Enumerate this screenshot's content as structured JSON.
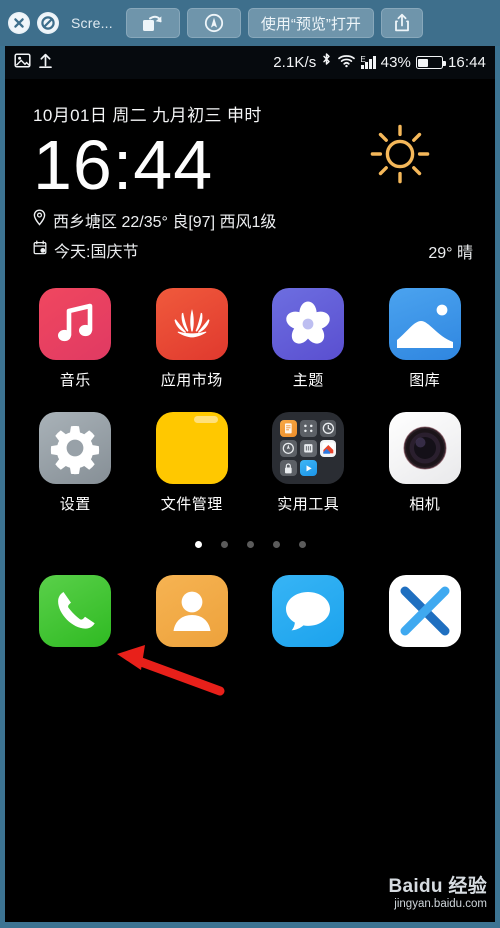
{
  "quicklook": {
    "close_label": "close",
    "block_label": "block",
    "title": "Scre...",
    "rotate_label": "rotate",
    "markup_label": "markup",
    "open_with_label": "使用“预览”打开",
    "share_label": "share"
  },
  "statusbar": {
    "screenshot_icon": "screenshot-icon",
    "upload_icon": "upload-icon",
    "network_speed": "2.1K/s",
    "bluetooth_icon": "bluetooth-icon",
    "wifi_icon": "wifi-icon",
    "signal_label": "E",
    "battery_percent": "43%",
    "battery_level": 43,
    "time": "16:44"
  },
  "widget": {
    "date": "10月01日 周二 九月初三 申时",
    "clock": "16:44",
    "location_icon": "location-pin-icon",
    "weather_line": "西乡塘区 22/35° 良[97] 西风1级",
    "calendar_icon": "calendar-icon",
    "festival_line": "今天:国庆节",
    "temp_now": "29° 晴",
    "weather_icon": "sun-icon",
    "sun_color": "#f5b85a"
  },
  "home": {
    "rows": [
      [
        {
          "label": "音乐",
          "icon": "music-note-icon",
          "tile": "t-music"
        },
        {
          "label": "应用市场",
          "icon": "huawei-logo-icon",
          "tile": "t-appmarket"
        },
        {
          "label": "主题",
          "icon": "theme-flower-icon",
          "tile": "t-theme"
        },
        {
          "label": "图库",
          "icon": "gallery-image-icon",
          "tile": "t-gallery"
        }
      ],
      [
        {
          "label": "设置",
          "icon": "gear-icon",
          "tile": "t-settings"
        },
        {
          "label": "文件管理",
          "icon": "folder-icon",
          "tile": "t-files"
        },
        {
          "label": "实用工具",
          "icon": "app-folder-icon",
          "tile": "t-folder"
        },
        {
          "label": "相机",
          "icon": "camera-lens-icon",
          "tile": "t-camera"
        }
      ]
    ],
    "page_dots": {
      "count": 5,
      "active": 0
    },
    "dock": [
      {
        "label": "",
        "icon": "phone-icon",
        "tile": "t-phone"
      },
      {
        "label": "",
        "icon": "contacts-icon",
        "tile": "t-contacts"
      },
      {
        "label": "",
        "icon": "messages-icon",
        "tile": "t-messages"
      },
      {
        "label": "",
        "icon": "x-app-icon",
        "tile": "t-x"
      }
    ]
  },
  "annotation": {
    "arrow_color": "#e8201a",
    "arrow_target": "设置"
  },
  "watermark": {
    "main": "Baidu 经验",
    "sub": "jingyan.baidu.com"
  }
}
